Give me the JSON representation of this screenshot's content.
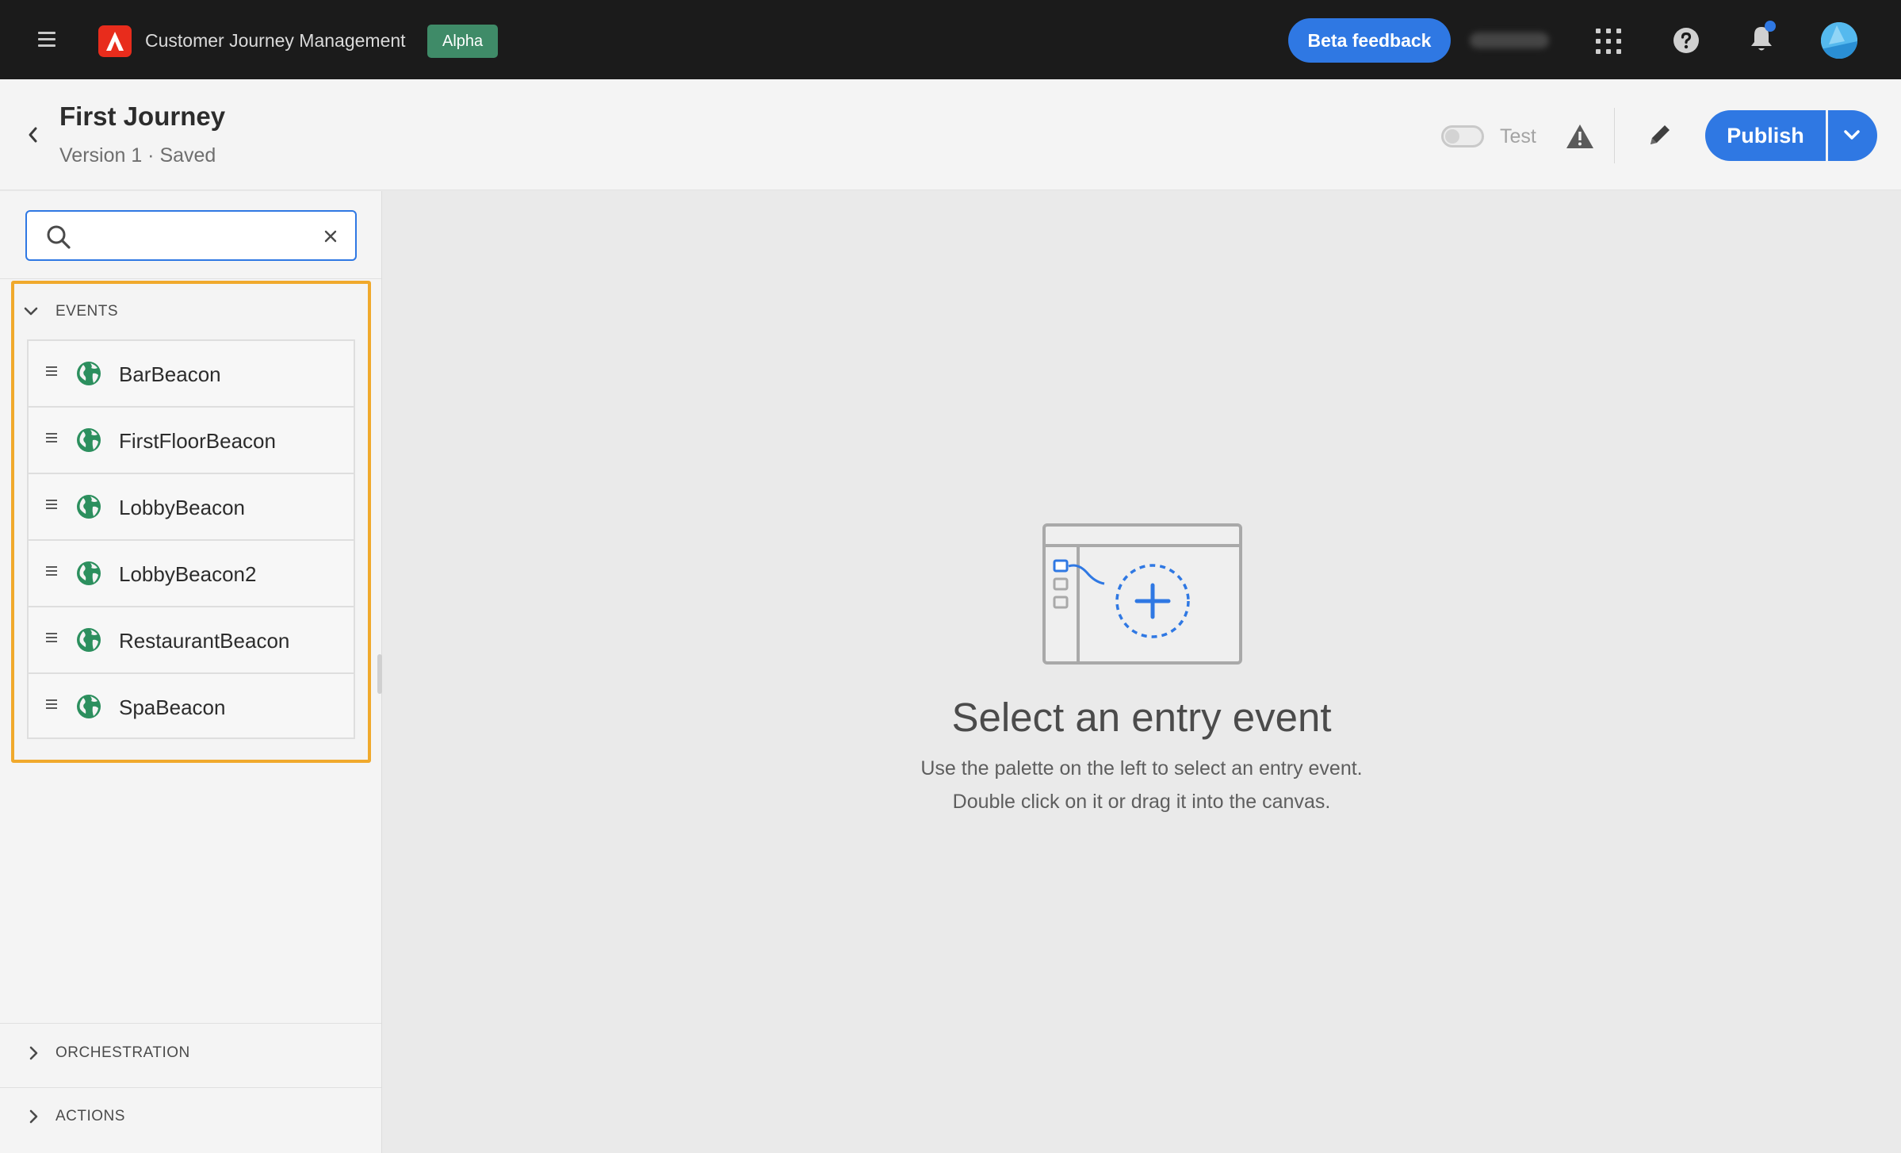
{
  "topbar": {
    "app_title": "Customer Journey Management",
    "badge": "Alpha",
    "beta_feedback": "Beta feedback"
  },
  "journey": {
    "title": "First Journey",
    "subtitle": "Version 1 · Saved",
    "test_label": "Test",
    "publish_label": "Publish"
  },
  "palette": {
    "search": {
      "value": "",
      "placeholder": ""
    },
    "events_section": {
      "label": "EVENTS",
      "expanded": true,
      "items": [
        {
          "label": "BarBeacon",
          "icon": "globe-icon"
        },
        {
          "label": "FirstFloorBeacon",
          "icon": "globe-icon"
        },
        {
          "label": "LobbyBeacon",
          "icon": "globe-icon"
        },
        {
          "label": "LobbyBeacon2",
          "icon": "globe-icon"
        },
        {
          "label": "RestaurantBeacon",
          "icon": "globe-icon"
        },
        {
          "label": "SpaBeacon",
          "icon": "globe-icon"
        }
      ]
    },
    "orchestration_section": {
      "label": "ORCHESTRATION",
      "expanded": false
    },
    "actions_section": {
      "label": "ACTIONS",
      "expanded": false
    }
  },
  "canvas": {
    "empty_title": "Select an entry event",
    "empty_line1": "Use the palette on the left to select an entry event.",
    "empty_line2": "Double click on it or drag it into the canvas."
  },
  "colors": {
    "topbar_bg": "#1b1b1b",
    "accent_blue": "#2f78e3",
    "alpha_badge": "#3f8b68",
    "highlight_frame": "#f0a92c",
    "globe_green": "#2c8f5e",
    "adobe_red": "#e82c1c"
  }
}
